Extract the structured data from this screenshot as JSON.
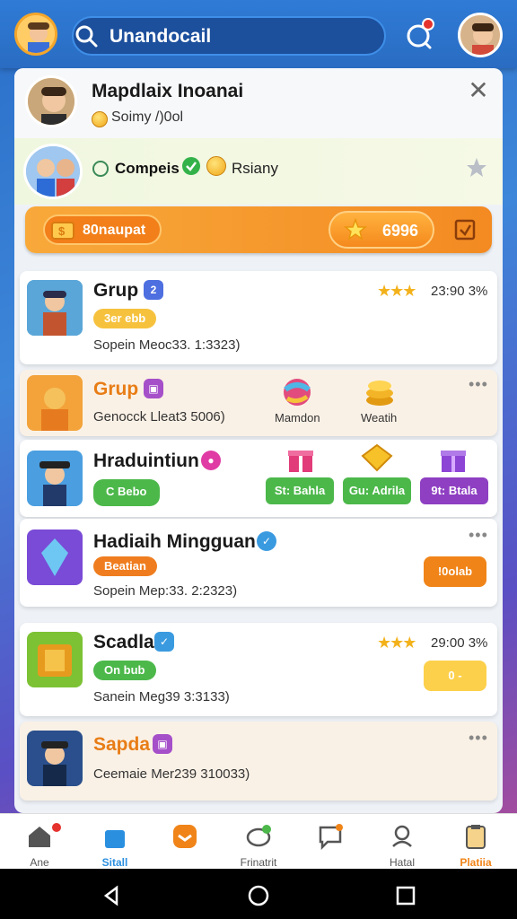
{
  "topbar": {
    "search_text": "Unandocail"
  },
  "header_card": {
    "title": "Mapdlaix Inoanai",
    "subtitle": "Soimy /)0ol"
  },
  "comp_row": {
    "label1": "Compeis",
    "label2": "Rsiany"
  },
  "orange_bar": {
    "pill_label": "80naupat",
    "score": "6996"
  },
  "cards": [
    {
      "title": "Grup",
      "badge": "2",
      "chip": "3er ebb",
      "meta": "Sopein Meoc33. 1:3323)",
      "rating": "23:90 3%"
    },
    {
      "title": "Grup",
      "meta": "Genocck Lleat3 5006)",
      "item1": "Mamdon",
      "item2": "Weatih"
    },
    {
      "title": "Hraduintiun",
      "chip": "C Bebo",
      "btn1": "St: Bahla",
      "btn2": "Gu: Adrila",
      "btn3": "9t: Btala"
    },
    {
      "title": "Hadiaih Mingguan",
      "chip": "Beatian",
      "meta": "Sopein Mep:33. 2:2323)",
      "action": "!0olab"
    },
    {
      "title": "Scadla",
      "chip": "On bub",
      "meta": "Sanein Meg39 3:3133)",
      "rating": "29:00 3%",
      "action": "0 -"
    },
    {
      "title": "Sapda",
      "meta": "Ceemaie Mer239 310033)"
    }
  ],
  "nav": [
    {
      "label": "Ane"
    },
    {
      "label": "Sitall"
    },
    {
      "label": ""
    },
    {
      "label": "Frinatrit"
    },
    {
      "label": ""
    },
    {
      "label": "Hatal"
    },
    {
      "label": "Platiia"
    }
  ],
  "colors": {
    "accent": "#f38a22",
    "primary": "#2f7bd6",
    "green": "#4cb84a",
    "purple": "#8e3fc2"
  }
}
